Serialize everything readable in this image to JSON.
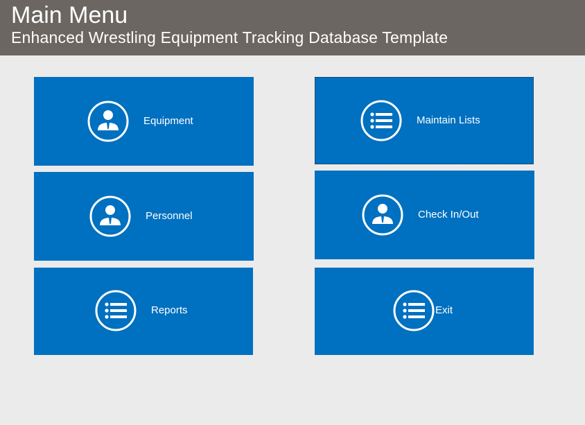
{
  "header": {
    "title": "Main Menu",
    "subtitle": "Enhanced Wrestling Equipment Tracking Database Template"
  },
  "colors": {
    "header_bg": "#6b6661",
    "tile_bg": "#0070c0",
    "page_bg": "#ebebeb",
    "text": "#ffffff"
  },
  "tiles": {
    "equipment": {
      "label": "Equipment",
      "icon": "person-icon"
    },
    "maintain_lists": {
      "label": "Maintain Lists",
      "icon": "list-icon"
    },
    "personnel": {
      "label": "Personnel",
      "icon": "person-icon"
    },
    "check_in_out": {
      "label": "Check In/Out",
      "icon": "person-icon"
    },
    "reports": {
      "label": "Reports",
      "icon": "list-icon"
    },
    "exit": {
      "label": "Exit",
      "icon": "list-icon"
    }
  }
}
